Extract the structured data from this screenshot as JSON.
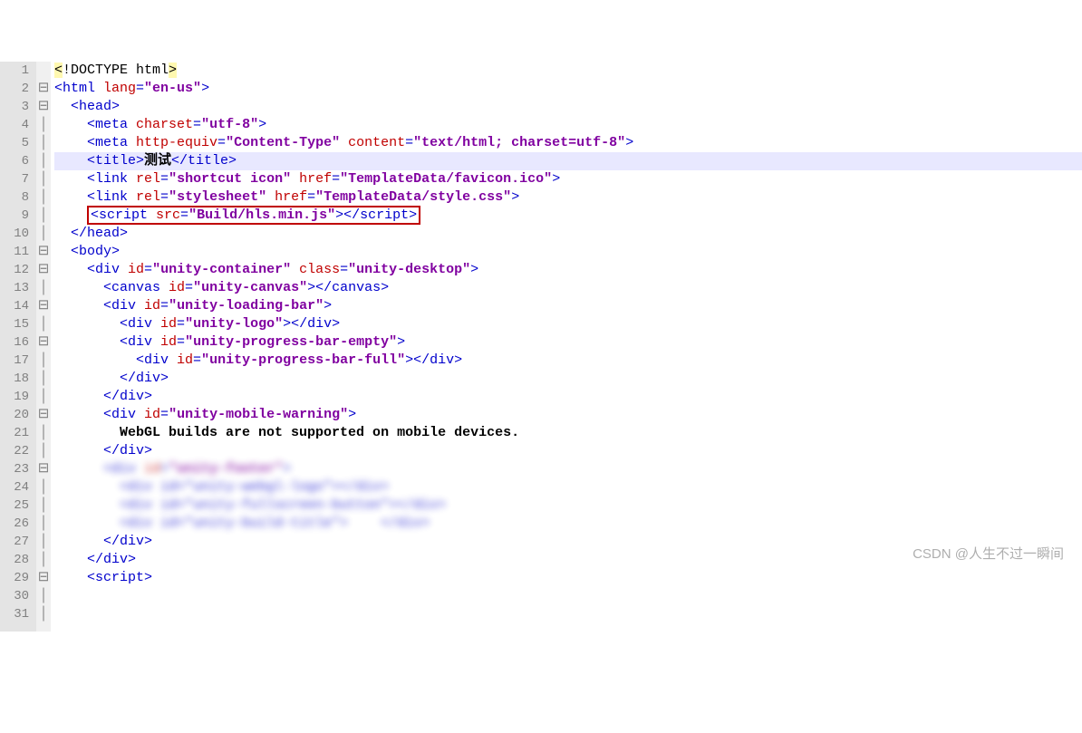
{
  "watermark": "CSDN @人生不过一瞬间",
  "lines": [
    {
      "n": "1",
      "f": " ",
      "i": 0,
      "tok": [
        {
          "c": "doctype-bg",
          "t": "<"
        },
        {
          "c": "doctype",
          "t": "!DOCTYPE html"
        },
        {
          "c": "doctype-bg",
          "t": ">"
        }
      ]
    },
    {
      "n": "2",
      "f": "⊟",
      "i": 0,
      "tok": [
        {
          "c": "tag",
          "t": "<html "
        },
        {
          "c": "attr",
          "t": "lang"
        },
        {
          "c": "tag",
          "t": "="
        },
        {
          "c": "str",
          "t": "\"en-us\""
        },
        {
          "c": "tag",
          "t": ">"
        }
      ]
    },
    {
      "n": "3",
      "f": "⊟",
      "i": 1,
      "tok": [
        {
          "c": "tag",
          "t": "<head>"
        }
      ]
    },
    {
      "n": "4",
      "f": "│",
      "i": 2,
      "tok": [
        {
          "c": "tag",
          "t": "<meta "
        },
        {
          "c": "attr",
          "t": "charset"
        },
        {
          "c": "tag",
          "t": "="
        },
        {
          "c": "str",
          "t": "\"utf-8\""
        },
        {
          "c": "tag",
          "t": ">"
        }
      ]
    },
    {
      "n": "5",
      "f": "│",
      "i": 2,
      "tok": [
        {
          "c": "tag",
          "t": "<meta "
        },
        {
          "c": "attr",
          "t": "http-equiv"
        },
        {
          "c": "tag",
          "t": "="
        },
        {
          "c": "str",
          "t": "\"Content-Type\""
        },
        {
          "c": "tag",
          "t": " "
        },
        {
          "c": "attr",
          "t": "content"
        },
        {
          "c": "tag",
          "t": "="
        },
        {
          "c": "str",
          "t": "\"text/html; charset=utf-8\""
        },
        {
          "c": "tag",
          "t": ">"
        }
      ]
    },
    {
      "n": "6",
      "f": "│",
      "i": 2,
      "hl": true,
      "tok": [
        {
          "c": "tag",
          "t": "<title>"
        },
        {
          "c": "txt",
          "t": "测试"
        },
        {
          "c": "tag",
          "t": "</title>"
        }
      ]
    },
    {
      "n": "7",
      "f": "│",
      "i": 2,
      "tok": [
        {
          "c": "tag",
          "t": "<link "
        },
        {
          "c": "attr",
          "t": "rel"
        },
        {
          "c": "tag",
          "t": "="
        },
        {
          "c": "str",
          "t": "\"shortcut icon\""
        },
        {
          "c": "tag",
          "t": " "
        },
        {
          "c": "attr",
          "t": "href"
        },
        {
          "c": "tag",
          "t": "="
        },
        {
          "c": "str",
          "t": "\"TemplateData/favicon.ico\""
        },
        {
          "c": "tag",
          "t": ">"
        }
      ]
    },
    {
      "n": "8",
      "f": "│",
      "i": 2,
      "tok": [
        {
          "c": "tag",
          "t": "<link "
        },
        {
          "c": "attr",
          "t": "rel"
        },
        {
          "c": "tag",
          "t": "="
        },
        {
          "c": "str",
          "t": "\"stylesheet\""
        },
        {
          "c": "tag",
          "t": " "
        },
        {
          "c": "attr",
          "t": "href"
        },
        {
          "c": "tag",
          "t": "="
        },
        {
          "c": "str",
          "t": "\"TemplateData/style.css\""
        },
        {
          "c": "tag",
          "t": ">"
        }
      ]
    },
    {
      "n": "9",
      "f": "│",
      "i": 2,
      "box": true,
      "tok": [
        {
          "c": "tag",
          "t": "<script "
        },
        {
          "c": "attr",
          "t": "src"
        },
        {
          "c": "tag",
          "t": "="
        },
        {
          "c": "str",
          "t": "\"Build/hls.min.js\""
        },
        {
          "c": "tag",
          "t": "></script>"
        }
      ]
    },
    {
      "n": "10",
      "f": "│",
      "i": 1,
      "tok": [
        {
          "c": "tag",
          "t": "</head>"
        }
      ]
    },
    {
      "n": "11",
      "f": "⊟",
      "i": 1,
      "tok": [
        {
          "c": "tag",
          "t": "<body>"
        }
      ]
    },
    {
      "n": "12",
      "f": "⊟",
      "i": 2,
      "tok": [
        {
          "c": "tag",
          "t": "<div "
        },
        {
          "c": "attr",
          "t": "id"
        },
        {
          "c": "tag",
          "t": "="
        },
        {
          "c": "str",
          "t": "\"unity-container\""
        },
        {
          "c": "tag",
          "t": " "
        },
        {
          "c": "attr",
          "t": "class"
        },
        {
          "c": "tag",
          "t": "="
        },
        {
          "c": "str",
          "t": "\"unity-desktop\""
        },
        {
          "c": "tag",
          "t": ">"
        }
      ]
    },
    {
      "n": "13",
      "f": "│",
      "i": 3,
      "tok": [
        {
          "c": "tag",
          "t": "<canvas "
        },
        {
          "c": "attr",
          "t": "id"
        },
        {
          "c": "tag",
          "t": "="
        },
        {
          "c": "str",
          "t": "\"unity-canvas\""
        },
        {
          "c": "tag",
          "t": "></canvas>"
        }
      ]
    },
    {
      "n": "14",
      "f": "⊟",
      "i": 3,
      "tok": [
        {
          "c": "tag",
          "t": "<div "
        },
        {
          "c": "attr",
          "t": "id"
        },
        {
          "c": "tag",
          "t": "="
        },
        {
          "c": "str",
          "t": "\"unity-loading-bar\""
        },
        {
          "c": "tag",
          "t": ">"
        }
      ]
    },
    {
      "n": "15",
      "f": "│",
      "i": 4,
      "tok": [
        {
          "c": "tag",
          "t": "<div "
        },
        {
          "c": "attr",
          "t": "id"
        },
        {
          "c": "tag",
          "t": "="
        },
        {
          "c": "str",
          "t": "\"unity-logo\""
        },
        {
          "c": "tag",
          "t": "></div>"
        }
      ]
    },
    {
      "n": "16",
      "f": "⊟",
      "i": 4,
      "tok": [
        {
          "c": "tag",
          "t": "<div "
        },
        {
          "c": "attr",
          "t": "id"
        },
        {
          "c": "tag",
          "t": "="
        },
        {
          "c": "str",
          "t": "\"unity-progress-bar-empty\""
        },
        {
          "c": "tag",
          "t": ">"
        }
      ]
    },
    {
      "n": "17",
      "f": "│",
      "i": 5,
      "tok": [
        {
          "c": "tag",
          "t": "<div "
        },
        {
          "c": "attr",
          "t": "id"
        },
        {
          "c": "tag",
          "t": "="
        },
        {
          "c": "str",
          "t": "\"unity-progress-bar-full\""
        },
        {
          "c": "tag",
          "t": "></div>"
        }
      ]
    },
    {
      "n": "18",
      "f": "│",
      "i": 4,
      "tok": [
        {
          "c": "tag",
          "t": "</div>"
        }
      ]
    },
    {
      "n": "19",
      "f": "│",
      "i": 3,
      "tok": [
        {
          "c": "tag",
          "t": "</div>"
        }
      ]
    },
    {
      "n": "20",
      "f": "⊟",
      "i": 3,
      "tok": [
        {
          "c": "tag",
          "t": "<div "
        },
        {
          "c": "attr",
          "t": "id"
        },
        {
          "c": "tag",
          "t": "="
        },
        {
          "c": "str",
          "t": "\"unity-mobile-warning\""
        },
        {
          "c": "tag",
          "t": ">"
        }
      ]
    },
    {
      "n": "21",
      "f": "│",
      "i": 4,
      "tok": [
        {
          "c": "txt",
          "t": "WebGL builds are not supported on mobile devices."
        }
      ]
    },
    {
      "n": "22",
      "f": "│",
      "i": 3,
      "tok": [
        {
          "c": "tag",
          "t": "</div>"
        }
      ]
    },
    {
      "n": "23",
      "f": "⊟",
      "i": 3,
      "blur": true,
      "tok": [
        {
          "c": "tag",
          "t": "<div "
        },
        {
          "c": "attr",
          "t": "id"
        },
        {
          "c": "tag",
          "t": "="
        },
        {
          "c": "str",
          "t": "\"unity-footer\""
        },
        {
          "c": "tag",
          "t": ">"
        }
      ]
    },
    {
      "n": "24",
      "f": "│",
      "i": 4,
      "blur": true,
      "tok": [
        {
          "c": "tag",
          "t": "<div id=\"unity-webgl-logo\"></div>"
        }
      ]
    },
    {
      "n": "25",
      "f": "│",
      "i": 4,
      "blur": true,
      "tok": [
        {
          "c": "tag",
          "t": "<div id=\"unity-fullscreen-button\"></div>"
        }
      ]
    },
    {
      "n": "26",
      "f": "│",
      "i": 4,
      "blur": true,
      "tok": [
        {
          "c": "tag",
          "t": "<div id=\"unity-build-title\">    </div>"
        }
      ]
    },
    {
      "n": "27",
      "f": "│",
      "i": 3,
      "tok": [
        {
          "c": "tag",
          "t": "</div>"
        }
      ]
    },
    {
      "n": "28",
      "f": "│",
      "i": 2,
      "tok": [
        {
          "c": "tag",
          "t": "</div>"
        }
      ]
    },
    {
      "n": "29",
      "f": "⊟",
      "i": 2,
      "tok": [
        {
          "c": "tag",
          "t": "<script>"
        }
      ]
    },
    {
      "n": "30",
      "f": "│",
      "i": 3,
      "blur": true,
      "tok": [
        {
          "c": "txt",
          "t": "                      "
        }
      ]
    },
    {
      "n": "31",
      "f": "│",
      "i": 3,
      "blur": true,
      "tok": [
        {
          "c": "txt",
          "t": "                          "
        }
      ]
    }
  ]
}
